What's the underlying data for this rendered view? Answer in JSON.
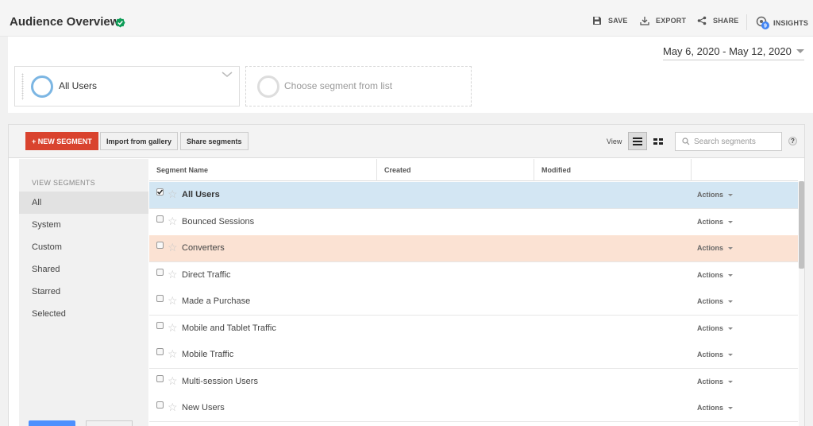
{
  "header": {
    "title": "Audience Overview",
    "verified_icon": "verified-check-icon",
    "buttons": {
      "save": "SAVE",
      "export": "EXPORT",
      "share": "SHARE",
      "insights": "INSIGHTS"
    },
    "insights_badge": "9"
  },
  "date_range": "May 6, 2020 - May 12, 2020",
  "segments": {
    "selected_label": "All Users",
    "empty_label": "Choose segment from list"
  },
  "toolbar": {
    "new_segment": "+ NEW SEGMENT",
    "import_gallery": "Import from gallery",
    "share_segments": "Share segments",
    "view_label": "View",
    "search_placeholder": "Search segments",
    "help": "?"
  },
  "sidebar": {
    "heading": "VIEW SEGMENTS",
    "items": [
      "All",
      "System",
      "Custom",
      "Shared",
      "Starred",
      "Selected"
    ],
    "active": "All"
  },
  "table": {
    "columns": [
      "Segment Name",
      "Created",
      "Modified"
    ],
    "rows": [
      {
        "name": "All Users",
        "checked": true,
        "actions": "Actions"
      },
      {
        "name": "Bounced Sessions",
        "checked": false,
        "actions": "Actions"
      },
      {
        "name": "Converters",
        "checked": false,
        "actions": "Actions"
      },
      {
        "name": "Direct Traffic",
        "checked": false,
        "actions": "Actions"
      },
      {
        "name": "Made a Purchase",
        "checked": false,
        "actions": "Actions"
      },
      {
        "name": "Mobile and Tablet Traffic",
        "checked": false,
        "actions": "Actions"
      },
      {
        "name": "Mobile Traffic",
        "checked": false,
        "actions": "Actions"
      },
      {
        "name": "Multi-session Users",
        "checked": false,
        "actions": "Actions"
      },
      {
        "name": "New Users",
        "checked": false,
        "actions": "Actions"
      }
    ]
  },
  "colors": {
    "accent_red": "#d9432e",
    "selected_row": "#d3e6f3",
    "hover_row": "#fbe2d3",
    "ring_blue": "#7cb6e3",
    "verified_green": "#0f9d58"
  }
}
